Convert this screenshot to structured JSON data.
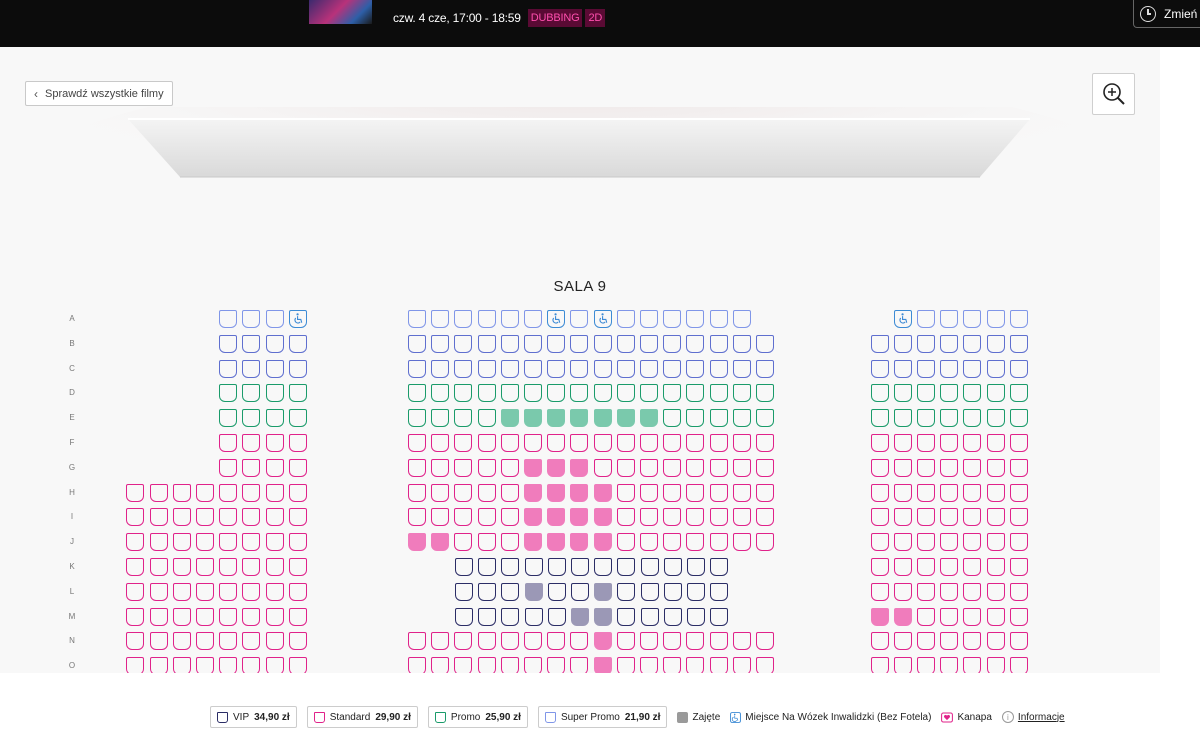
{
  "header": {
    "session_text": "czw. 4 cze, 17:00 - 18:59",
    "tags": [
      "DUBBING",
      "2D"
    ],
    "change_label": "Zmień"
  },
  "nav": {
    "back_label": "Sprawdź wszystkie filmy"
  },
  "hall": {
    "name": "SALA 9"
  },
  "rows": [
    "A",
    "B",
    "C",
    "D",
    "E",
    "F",
    "G",
    "H",
    "I",
    "J",
    "K",
    "L",
    "M",
    "N",
    "O"
  ],
  "colors": {
    "vip": "#5f6fcf",
    "standard": "#e0228a",
    "promo": "#1a9b6a",
    "super_promo": "#8096e8",
    "taken": "#9a9a9a",
    "wheelchair": "#3d8bd5",
    "sofa": "#e0228a"
  },
  "seating": {
    "A": {
      "left": "EEEW",
      "center": "EEEEEEWEWEEEEEE",
      "right": "WEEEEE"
    },
    "B": {
      "left": "vvvv",
      "center": "vvvvvvvvvvvvvvvv",
      "right": "vvvvvvv"
    },
    "C": {
      "left": "vvvv",
      "center": "vvvvvvvvvvvvvvvv",
      "right": "vvvvvvv"
    },
    "D": {
      "left": "pppp",
      "center": "pppppppppppppppp",
      "right": "ppppppp"
    },
    "E": {
      "left": "pppp",
      "center": "ppppPPPPPPPppppp",
      "right": "ppppppp"
    },
    "F": {
      "left": "ssss",
      "center": "ssssssssssssssss",
      "right": "sssssss"
    },
    "G": {
      "left": "ssss",
      "center": "sssssSSSssssssss",
      "right": "sssssss"
    },
    "H": {
      "left": "ssssssss",
      "center": "sssssSSSSsssssss",
      "right": "sssssss"
    },
    "I": {
      "left": "ssssssss",
      "center": "sssssSSSSsssssss",
      "right": "sssssss"
    },
    "J": {
      "left": "ssssssss",
      "center": "SSsssSSSSsssssss",
      "right": "sssssss"
    },
    "K": {
      "left": "ssssssss",
      "center": "nnnnnnnnnnnn",
      "right": "sssssss"
    },
    "L": {
      "left": "ssssssss",
      "center": "nnnNnnNnnnnn",
      "right": "sssssss"
    },
    "M": {
      "left": "ssssssss",
      "center": "nnnnnNNnnnnn",
      "right": "SSsssss"
    },
    "N": {
      "left": "ssssssss",
      "center": "ssssssssSsssssss",
      "right": "sssssss"
    },
    "O": {
      "left": "ssssssss",
      "center": "ssssssssSsssssss",
      "right": "sssssss"
    }
  },
  "legend": {
    "vip_label": "VIP",
    "vip_price": "34,90 zł",
    "standard_label": "Standard",
    "standard_price": "29,90 zł",
    "promo_label": "Promo",
    "promo_price": "25,90 zł",
    "super_promo_label": "Super Promo",
    "super_promo_price": "21,90 zł",
    "taken_label": "Zajęte",
    "wheelchair_label": "Miejsce Na Wózek Inwalidzki (Bez Fotela)",
    "sofa_label": "Kanapa",
    "info_label": "Informacje"
  }
}
